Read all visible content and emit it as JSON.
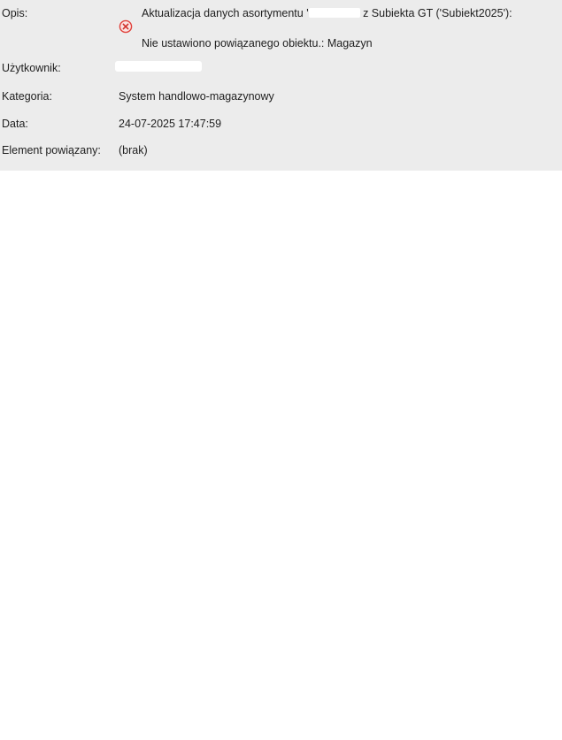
{
  "fields": {
    "opis_label": "Opis:",
    "opis_line1_start": "Aktualizacja danych asortymentu '",
    "opis_line1_end": " z Subiekta GT ('Subiekt2025'):",
    "opis_line2": "Nie ustawiono powiązanego obiektu.: Magazyn",
    "opis_icon": "error-circle-x-icon",
    "uzytkownik_label": "Użytkownik:",
    "kategoria_label": "Kategoria:",
    "kategoria_value": "System handlowo-magazynowy",
    "data_label": "Data:",
    "data_value": "24-07-2025 17:47:59",
    "element_label": "Element powiązany:",
    "element_value": "(brak)"
  },
  "colors": {
    "panel_background": "#ececec",
    "error_icon": "#e0403a"
  }
}
